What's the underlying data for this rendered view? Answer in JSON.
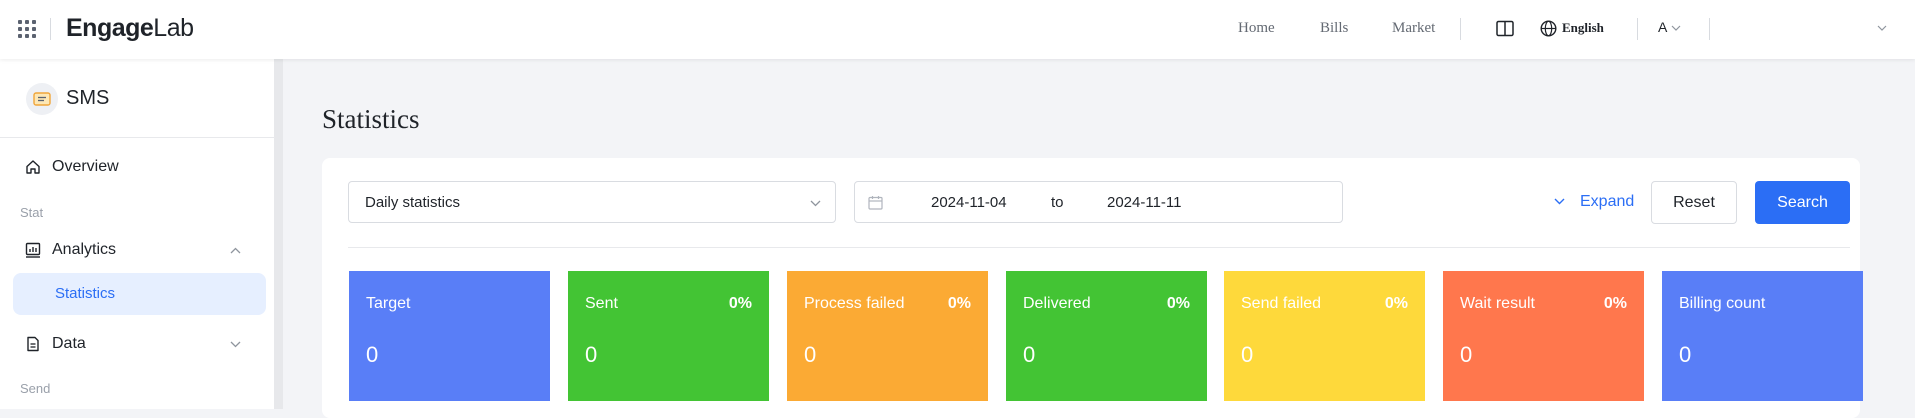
{
  "header": {
    "logo_text": "EngageLab",
    "nav": [
      "Home",
      "Bills",
      "Market"
    ],
    "language": "English",
    "account_initial": "A"
  },
  "sidebar": {
    "app_title": "SMS",
    "overview_label": "Overview",
    "group_stat": "Stat",
    "analytics_label": "Analytics",
    "statistics_label": "Statistics",
    "data_label": "Data",
    "group_send": "Send"
  },
  "main": {
    "page_title": "Statistics",
    "filters": {
      "period_value": "Daily statistics",
      "start_date": "2024-11-04",
      "to_label": "to",
      "end_date": "2024-11-11",
      "expand_label": "Expand",
      "reset_label": "Reset",
      "search_label": "Search"
    },
    "stats": [
      {
        "name": "Target",
        "percent": "",
        "value": "0",
        "color": "#597ef7"
      },
      {
        "name": "Sent",
        "percent": "0%",
        "value": "0",
        "color": "#43c434"
      },
      {
        "name": "Process failed",
        "percent": "0%",
        "value": "0",
        "color": "#fbaa34"
      },
      {
        "name": "Delivered",
        "percent": "0%",
        "value": "0",
        "color": "#43c434"
      },
      {
        "name": "Send failed",
        "percent": "0%",
        "value": "0",
        "color": "#fed93b"
      },
      {
        "name": "Wait result",
        "percent": "0%",
        "value": "0",
        "color": "#ff774d"
      },
      {
        "name": "Billing count",
        "percent": "",
        "value": "0",
        "color": "#597ef7"
      }
    ]
  },
  "colors": {
    "accent": "#2b6ef5",
    "active_bg": "#e6efff"
  }
}
